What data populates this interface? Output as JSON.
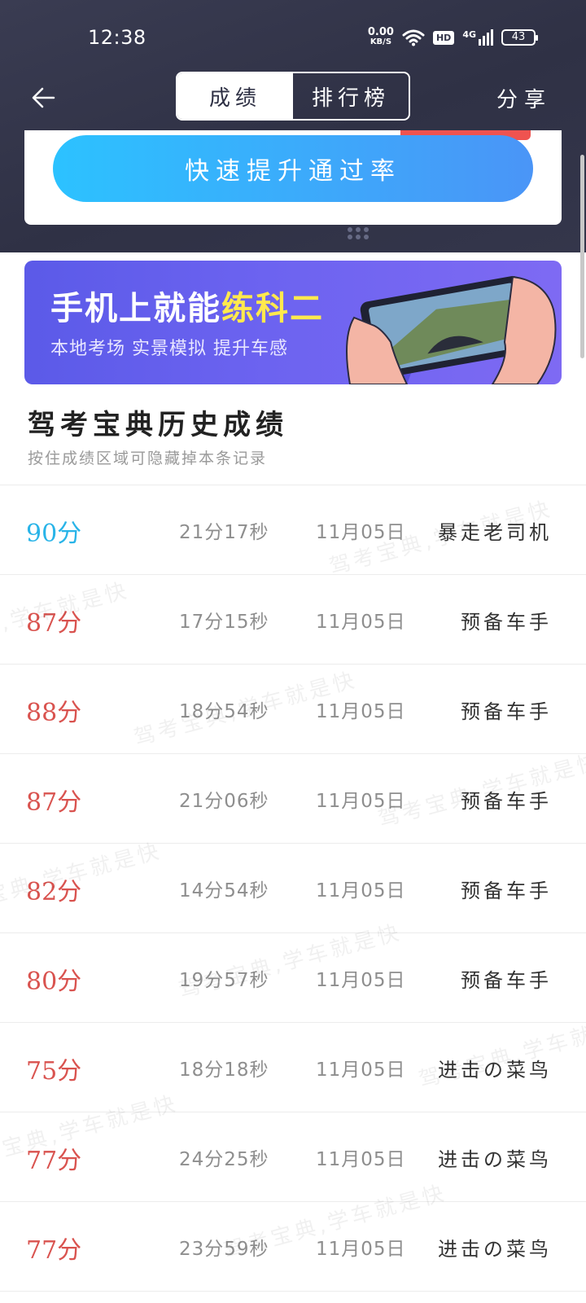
{
  "status_bar": {
    "time": "12:38",
    "net_speed": "0.00",
    "net_unit": "KB/S",
    "hd": "HD",
    "network": "4G",
    "battery": "43"
  },
  "nav": {
    "tabs": [
      {
        "label": "成绩",
        "active": true
      },
      {
        "label": "排行榜",
        "active": false
      }
    ],
    "share_label": "分享"
  },
  "boost_button_label": "快速提升通过率",
  "banner": {
    "title_prefix": "手机上就能",
    "title_highlight": "练科二",
    "subtitle": "本地考场 实景模拟 提升车感"
  },
  "history": {
    "title": "驾考宝典历史成绩",
    "hint": "按住成绩区域可隐藏掉本条记录",
    "records": [
      {
        "score": "90分",
        "duration": "21分17秒",
        "date": "11月05日",
        "rank": "暴走老司机",
        "color": "blue"
      },
      {
        "score": "87分",
        "duration": "17分15秒",
        "date": "11月05日",
        "rank": "预备车手",
        "color": "red"
      },
      {
        "score": "88分",
        "duration": "18分54秒",
        "date": "11月05日",
        "rank": "预备车手",
        "color": "red"
      },
      {
        "score": "87分",
        "duration": "21分06秒",
        "date": "11月05日",
        "rank": "预备车手",
        "color": "red"
      },
      {
        "score": "82分",
        "duration": "14分54秒",
        "date": "11月05日",
        "rank": "预备车手",
        "color": "red"
      },
      {
        "score": "80分",
        "duration": "19分57秒",
        "date": "11月05日",
        "rank": "预备车手",
        "color": "red"
      },
      {
        "score": "75分",
        "duration": "18分18秒",
        "date": "11月05日",
        "rank": "进击の菜鸟",
        "color": "red"
      },
      {
        "score": "77分",
        "duration": "24分25秒",
        "date": "11月05日",
        "rank": "进击の菜鸟",
        "color": "red"
      },
      {
        "score": "77分",
        "duration": "23分59秒",
        "date": "11月05日",
        "rank": "进击の菜鸟",
        "color": "red"
      }
    ]
  },
  "watermark_text": "驾考宝典,学车就是快",
  "colors": {
    "header_bg": "#33354a",
    "score_blue": "#29b4e8",
    "score_red": "#d9534f",
    "button_gradient_start": "#2cc2ff",
    "button_gradient_end": "#4a95f7",
    "banner_bg": "#6c63f0",
    "banner_highlight": "#ffe94d"
  }
}
